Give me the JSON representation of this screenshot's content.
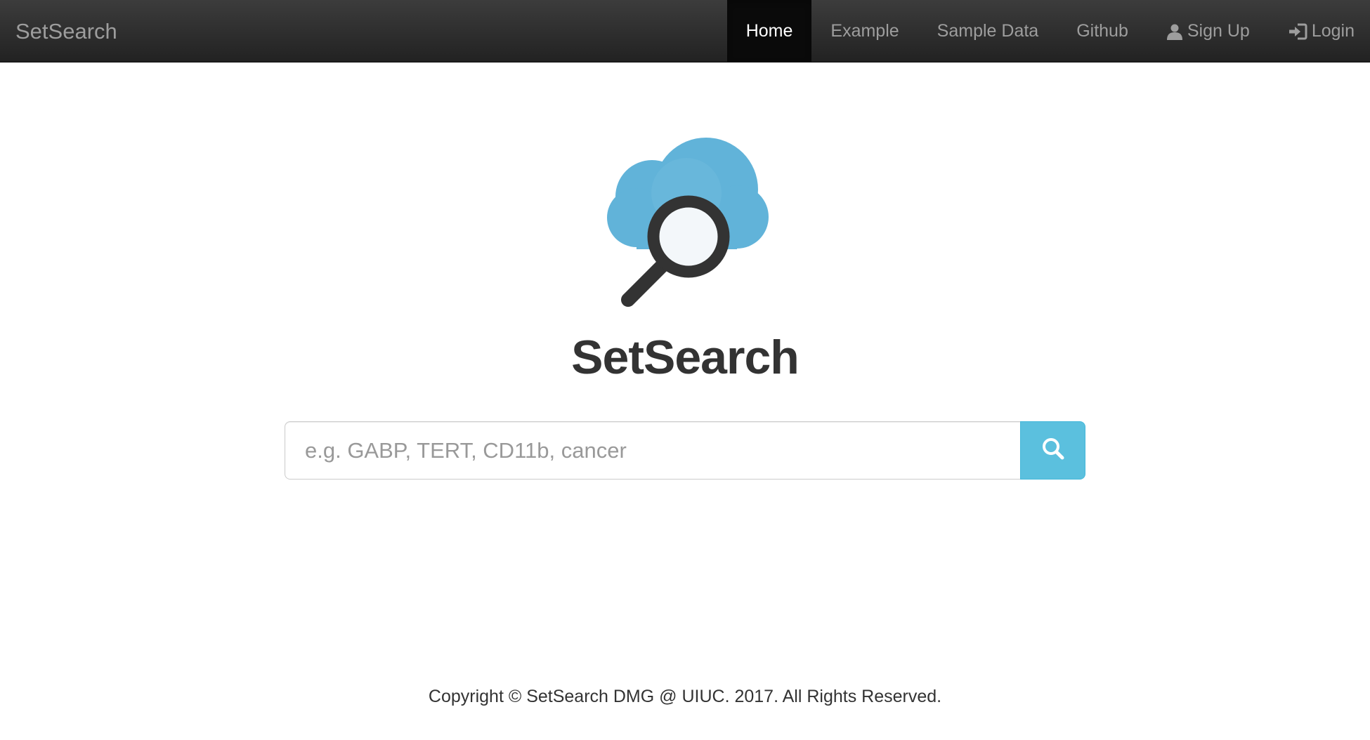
{
  "navbar": {
    "brand": "SetSearch",
    "items": [
      {
        "label": "Home",
        "active": true
      },
      {
        "label": "Example"
      },
      {
        "label": "Sample Data"
      },
      {
        "label": "Github"
      },
      {
        "label": "Sign Up",
        "icon": "user-icon"
      },
      {
        "label": "Login",
        "icon": "login-icon"
      }
    ]
  },
  "hero": {
    "logo_icon": "cloud-search-icon",
    "title": "SetSearch"
  },
  "search": {
    "placeholder": "e.g. GABP, TERT, CD11b, cancer",
    "value": "",
    "button_icon": "search-icon",
    "button_color": "#5bc0de"
  },
  "footer": {
    "text": "Copyright © SetSearch DMG @ UIUC. 2017. All Rights Reserved."
  },
  "colors": {
    "navbar_bg": "#222222",
    "cloud": "#5fb2d9",
    "magnifier": "#333333"
  }
}
